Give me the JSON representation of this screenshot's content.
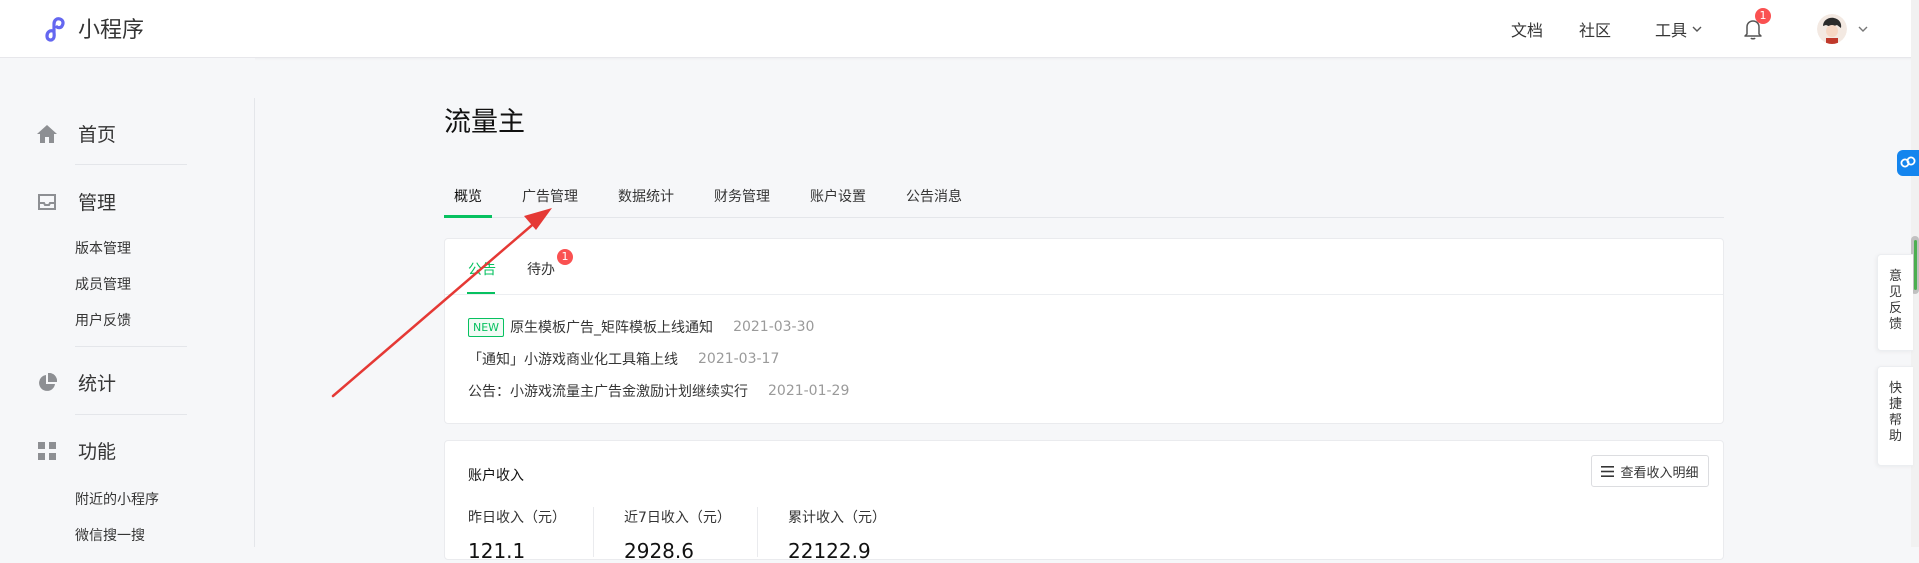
{
  "header": {
    "brand_title": "小程序",
    "nav": {
      "docs": "文档",
      "community": "社区",
      "tools": "工具"
    },
    "notification_count": "1"
  },
  "sidebar": {
    "home": "首页",
    "manage": "管理",
    "manage_items": [
      "版本管理",
      "成员管理",
      "用户反馈"
    ],
    "stats": "统计",
    "features": "功能",
    "feature_items": [
      "附近的小程序",
      "微信搜一搜"
    ]
  },
  "main": {
    "title": "流量主",
    "tabs": [
      "概览",
      "广告管理",
      "数据统计",
      "财务管理",
      "账户设置",
      "公告消息"
    ],
    "notice_card": {
      "subtabs": [
        "公告",
        "待办"
      ],
      "todo_count": "1",
      "new_tag": "NEW",
      "notices": [
        {
          "title": "原生模板广告_矩阵模板上线通知",
          "date": "2021-03-30"
        },
        {
          "title": "「通知」小游戏商业化工具箱上线",
          "date": "2021-03-17"
        },
        {
          "title": "公告：小游戏流量主广告金激励计划继续实行",
          "date": "2021-01-29"
        }
      ]
    },
    "income_card": {
      "title": "账户收入",
      "detail_button": "查看收入明细",
      "stats": [
        {
          "label": "昨日收入（元）",
          "value": "121.1"
        },
        {
          "label": "近7日收入（元）",
          "value": "2928.6"
        },
        {
          "label": "累计收入（元）",
          "value": "22122.9"
        }
      ]
    }
  },
  "floating": {
    "feedback": [
      "意",
      "见",
      "反",
      "馈"
    ],
    "help": [
      "快",
      "捷",
      "帮",
      "助"
    ]
  },
  "colors": {
    "accent": "#07c160",
    "badge": "#fa5151",
    "arrow": "#e53935",
    "float_blue": "#1485ee"
  }
}
